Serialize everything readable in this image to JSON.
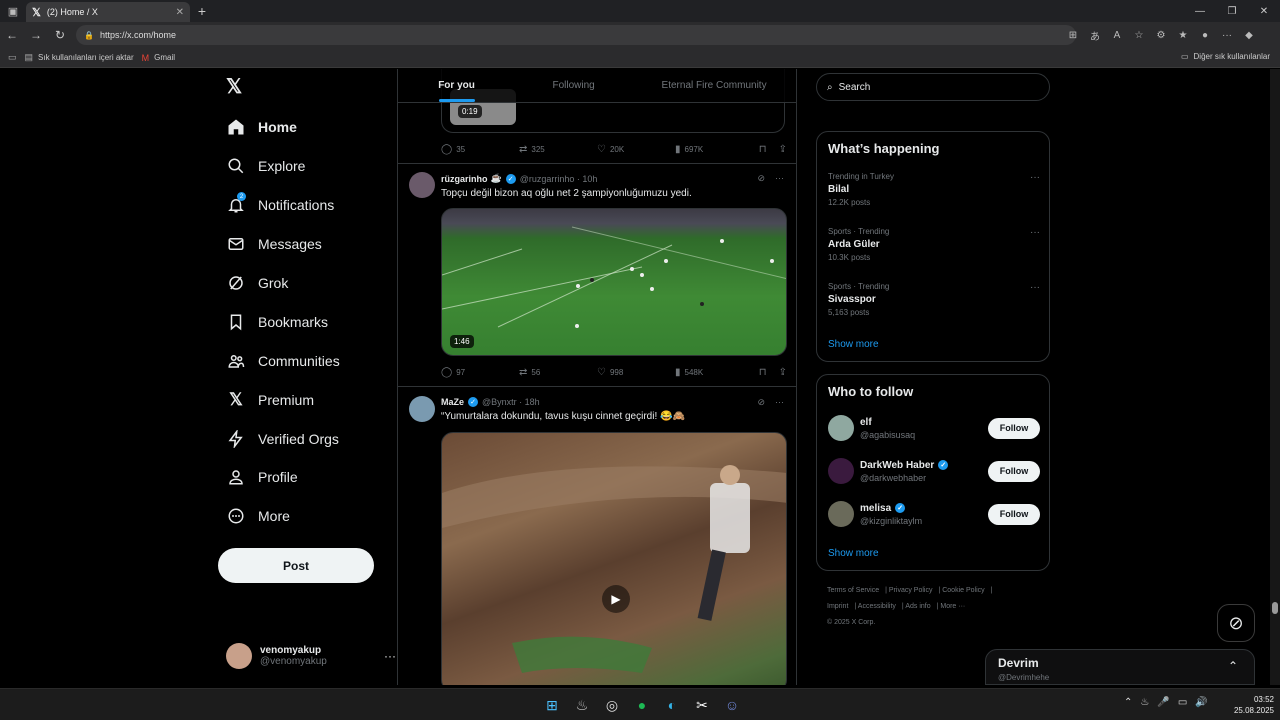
{
  "browser": {
    "tab_title": "(2) Home / X",
    "url": "https://x.com/home",
    "bookmarks": [
      {
        "label": "Sık kullanılanları içeri aktar",
        "icon": "import-icon"
      },
      {
        "label": "Gmail",
        "icon": "gmail-icon"
      }
    ],
    "other_favorites": "Diğer sık kullanılanlar"
  },
  "nav": {
    "items": [
      {
        "label": "Home",
        "icon": "home-icon"
      },
      {
        "label": "Explore",
        "icon": "search-icon"
      },
      {
        "label": "Notifications",
        "icon": "bell-icon",
        "badge": "2"
      },
      {
        "label": "Messages",
        "icon": "mail-icon"
      },
      {
        "label": "Grok",
        "icon": "grok-icon"
      },
      {
        "label": "Bookmarks",
        "icon": "bookmark-icon"
      },
      {
        "label": "Communities",
        "icon": "communities-icon"
      },
      {
        "label": "Premium",
        "icon": "x-icon"
      },
      {
        "label": "Verified Orgs",
        "icon": "lightning-icon"
      },
      {
        "label": "Profile",
        "icon": "person-icon"
      },
      {
        "label": "More",
        "icon": "more-circle-icon"
      }
    ],
    "post_label": "Post",
    "user": {
      "name": "venomyakup",
      "handle": "@venomyakup"
    }
  },
  "timeline": {
    "tabs": [
      "For you",
      "Following",
      "Eternal Fire Community"
    ],
    "prev": {
      "duration": "0:19",
      "replies": "35",
      "reposts": "325",
      "likes": "20K",
      "views": "697K"
    },
    "tweets": [
      {
        "name": "rüzgarinho",
        "emoji": "☕",
        "handle": "@ruzgarrinho · 10h",
        "text": "Topçu değil bizon aq oğlu net 2 şampiyonluğumuzu yedi.",
        "duration": "1:46",
        "replies": "97",
        "reposts": "56",
        "likes": "998",
        "views": "548K"
      },
      {
        "name": "MaZe",
        "handle": "@Bynxtr · 18h",
        "text": "“Yumurtalara dokundu, tavus kuşu cinnet geçirdi! 😂🙈"
      }
    ]
  },
  "right": {
    "search_placeholder": "Search",
    "happening": {
      "title": "What’s happening",
      "trends": [
        {
          "context": "Trending in Turkey",
          "topic": "Bilal",
          "posts": "12.2K posts"
        },
        {
          "context": "Sports · Trending",
          "topic": "Arda Güler",
          "posts": "10.3K posts"
        },
        {
          "context": "Sports · Trending",
          "topic": "Sivasspor",
          "posts": "5,163 posts"
        }
      ],
      "show_more": "Show more"
    },
    "who_to_follow": {
      "title": "Who to follow",
      "accounts": [
        {
          "name": "elf",
          "handle": "@agabisusaq",
          "verified": false
        },
        {
          "name": "DarkWeb Haber",
          "handle": "@darkwebhaber",
          "verified": true
        },
        {
          "name": "melisa",
          "handle": "@kizginliktaylm",
          "verified": true
        }
      ],
      "follow_label": "Follow",
      "show_more": "Show more"
    },
    "footer": [
      "Terms of Service",
      "Privacy Policy",
      "Cookie Policy",
      "Imprint",
      "Accessibility",
      "Ads info",
      "More ···",
      "© 2025 X Corp."
    ]
  },
  "dm": {
    "name": "Devrim",
    "handle": "@Devrimhehe"
  },
  "taskbar": {
    "time": "03:52",
    "date": "25.08.2025"
  },
  "colors": {
    "accent": "#1d9bf0",
    "background": "#000000",
    "border": "#2f3336",
    "muted": "#71767b"
  }
}
